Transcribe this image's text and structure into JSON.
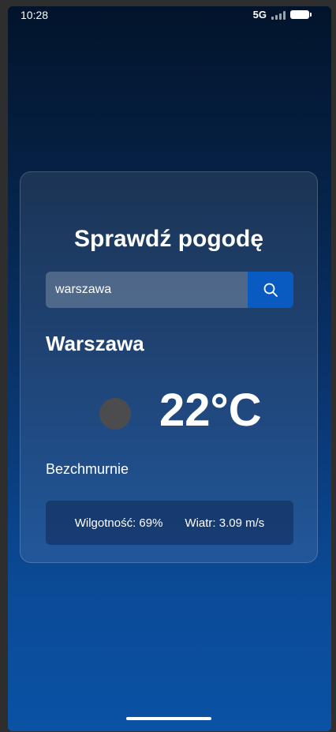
{
  "status_bar": {
    "time": "10:28",
    "network": "5G"
  },
  "weather_card": {
    "title": "Sprawdź pogodę",
    "search": {
      "value": "warszawa",
      "button_icon": "search-icon"
    },
    "city": "Warszawa",
    "condition_icon": "weather-condition-icon",
    "temperature": "22°C",
    "description": "Bezchmurnie",
    "details": {
      "humidity": "Wilgotność: 69%",
      "wind": "Wiatr: 3.09 m/s"
    }
  },
  "colors": {
    "accent": "#0a5bc1",
    "background_top": "#02142b",
    "background_bottom": "#0a52a5"
  }
}
